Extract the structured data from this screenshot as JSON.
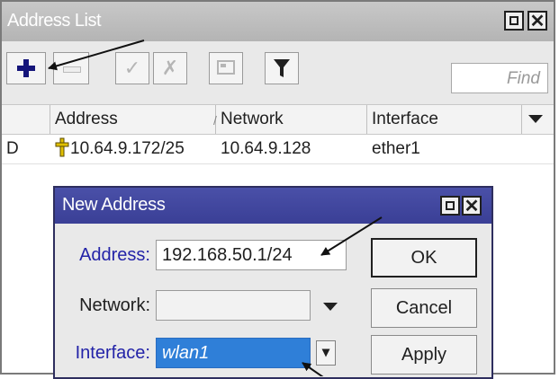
{
  "outer_window": {
    "title": "Address List",
    "restore_glyph": "",
    "close_glyph": "✕"
  },
  "toolbar": {
    "add_icon": "plus-icon",
    "remove_icon": "minus-icon",
    "enable_icon": "check-icon",
    "disable_icon": "cross-icon",
    "comment_icon": "comment-icon",
    "filter_icon": "filter-icon",
    "find_placeholder": "Find"
  },
  "table": {
    "columns": [
      "Address",
      "Network",
      "Interface"
    ],
    "sort_glyph": "/",
    "rows": [
      {
        "flag": "D",
        "address": "10.64.9.172/25",
        "network": "10.64.9.128",
        "interface": "ether1"
      }
    ]
  },
  "dialog": {
    "title": "New Address",
    "close_glyph": "✕",
    "address_label": "Address:",
    "address_value": "192.168.50.1/24",
    "network_label": "Network:",
    "network_value": "",
    "interface_label": "Interface:",
    "interface_value": "wlan1",
    "ok_label": "OK",
    "cancel_label": "Cancel",
    "apply_label": "Apply"
  },
  "colors": {
    "dialog_title_bg": "#3f449c",
    "label_blue": "#2323a8",
    "add_icon": "#15157a",
    "selection": "#2f7fd8"
  }
}
